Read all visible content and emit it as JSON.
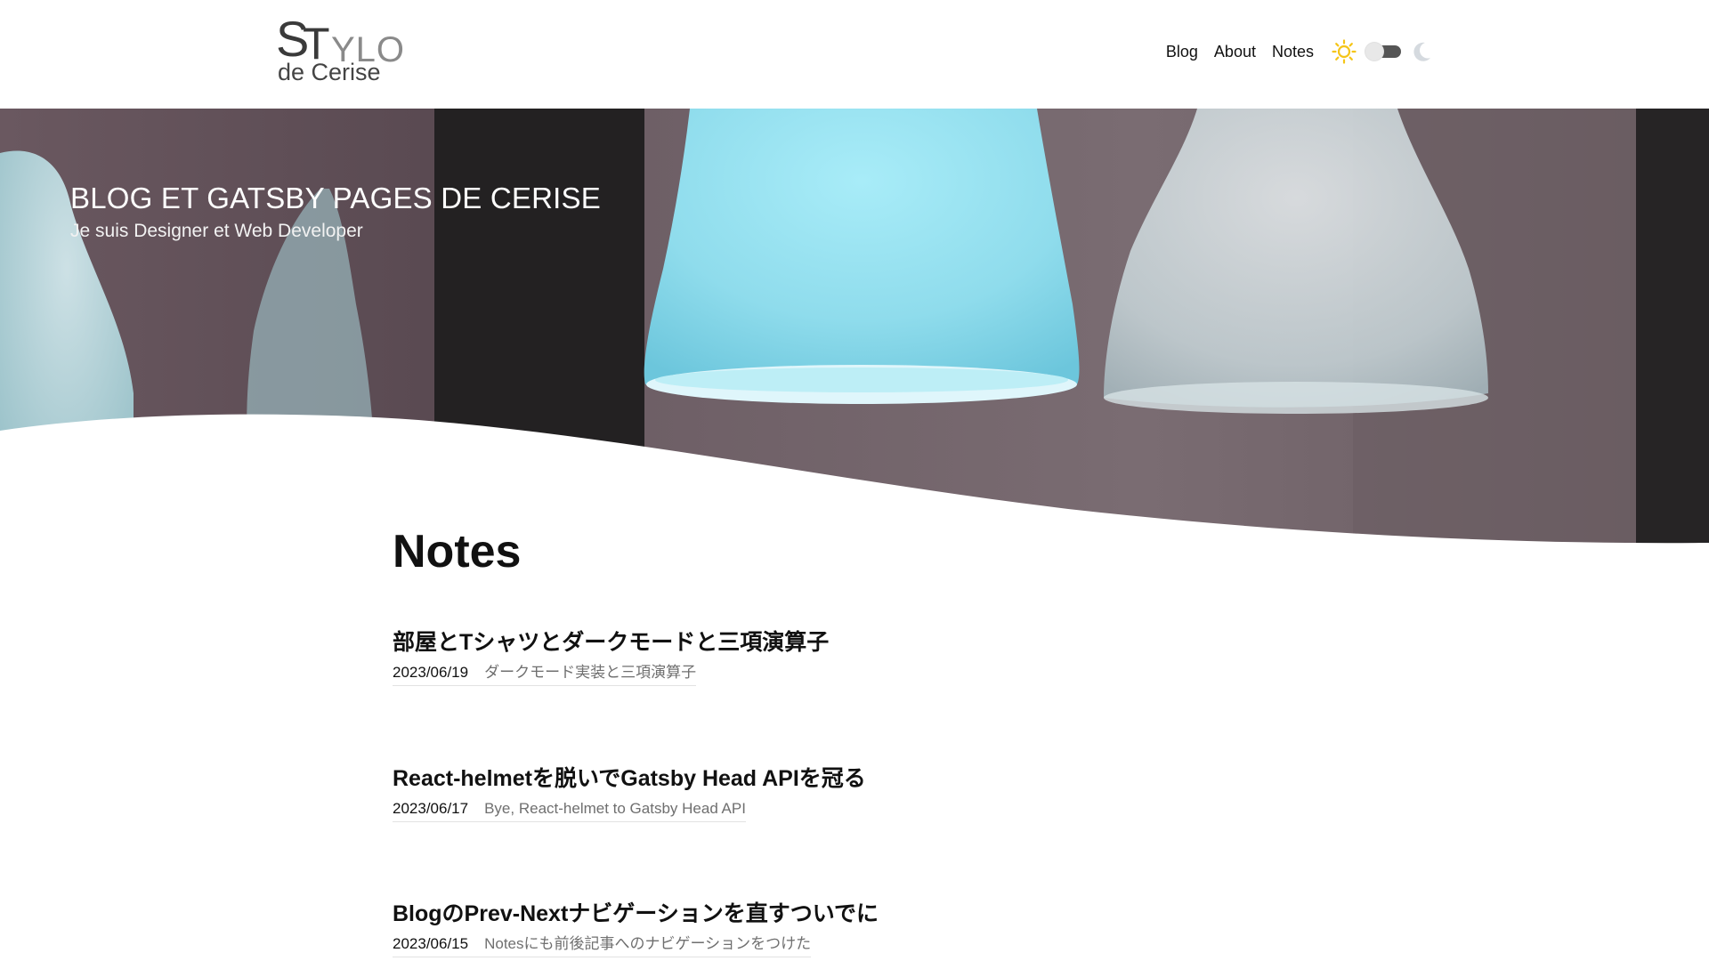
{
  "header": {
    "logo": {
      "line1_s": "S",
      "line1_t": "T",
      "line1_rest": "YLO",
      "line2": "de Cerise"
    },
    "nav": [
      {
        "label": "Blog"
      },
      {
        "label": "About"
      },
      {
        "label": "Notes"
      }
    ],
    "theme_toggle": {
      "state": "light"
    }
  },
  "hero": {
    "title": "BLOG ET GATSBY PAGES DE CERISE",
    "subtitle": "Je suis Designer et Web Developer"
  },
  "main": {
    "heading": "Notes",
    "notes": [
      {
        "title": "部屋とTシャツとダークモードと三項演算子",
        "date": "2023/06/19",
        "description": "ダークモード実装と三項演算子"
      },
      {
        "title": "React-helmetを脱いでGatsby Head APIを冠る",
        "date": "2023/06/17",
        "description": "Bye, React-helmet to Gatsby Head API"
      },
      {
        "title": "BlogのPrev-Nextナビゲーションを直すついでに",
        "date": "2023/06/15",
        "description": "Notesにも前後記事へのナビゲーションをつけた"
      }
    ]
  },
  "colors": {
    "accent_sun": "#f5c518",
    "toggle_track": "#555555",
    "moon": "#d0d4d8",
    "lamp_blue": "#8fdcec"
  }
}
